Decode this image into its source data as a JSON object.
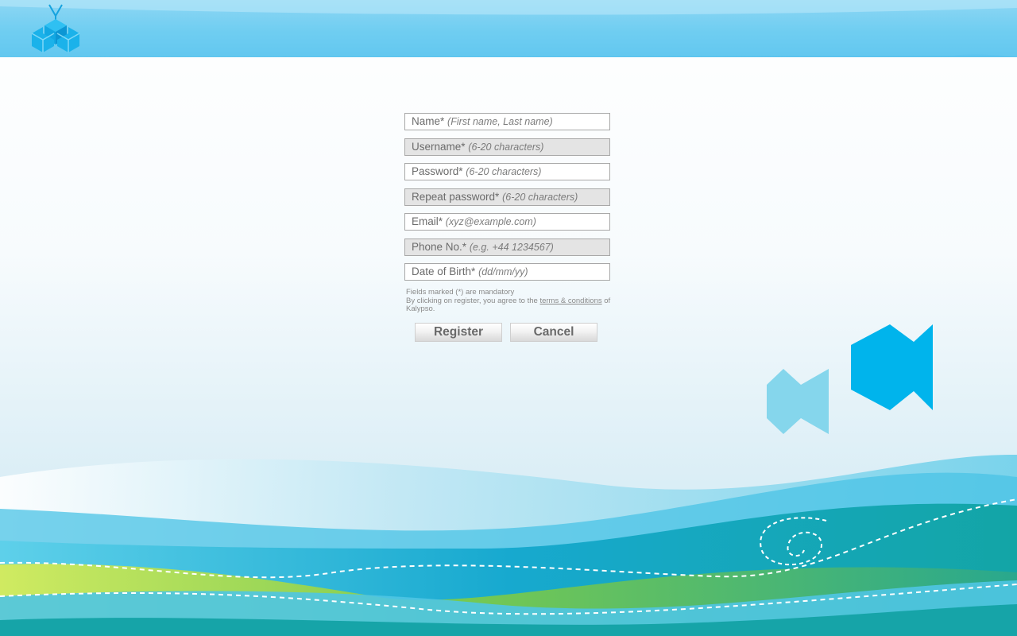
{
  "app": {
    "brand": "Kalypso",
    "colors": {
      "header": "#6fcdf2",
      "accent": "#00b4ec",
      "fish_light": "#85d6ec",
      "wave_green": "#7ccb4a",
      "wave_teal": "#1aa5a8"
    },
    "logo_icon": "cube-logo-icon"
  },
  "form": {
    "fields": [
      {
        "label": "Name*",
        "hint": "(First name, Last name)"
      },
      {
        "label": "Username*",
        "hint": "(6-20 characters)"
      },
      {
        "label": "Password*",
        "hint": "(6-20 characters)"
      },
      {
        "label": "Repeat password*",
        "hint": "(6-20 characters)"
      },
      {
        "label": "Email*",
        "hint": "(xyz@example.com)"
      },
      {
        "label": "Phone No.*",
        "hint": "(e.g. +44 1234567)"
      },
      {
        "label": "Date of Birth*",
        "hint": "(dd/mm/yy)"
      }
    ],
    "mandatory_note": "Fields marked (*) are mandatory",
    "agree_prefix": "By clicking on register, you agree to the",
    "terms_link": "terms & conditions",
    "agree_suffix": "of Kalypso.",
    "register_label": "Register",
    "cancel_label": "Cancel"
  }
}
